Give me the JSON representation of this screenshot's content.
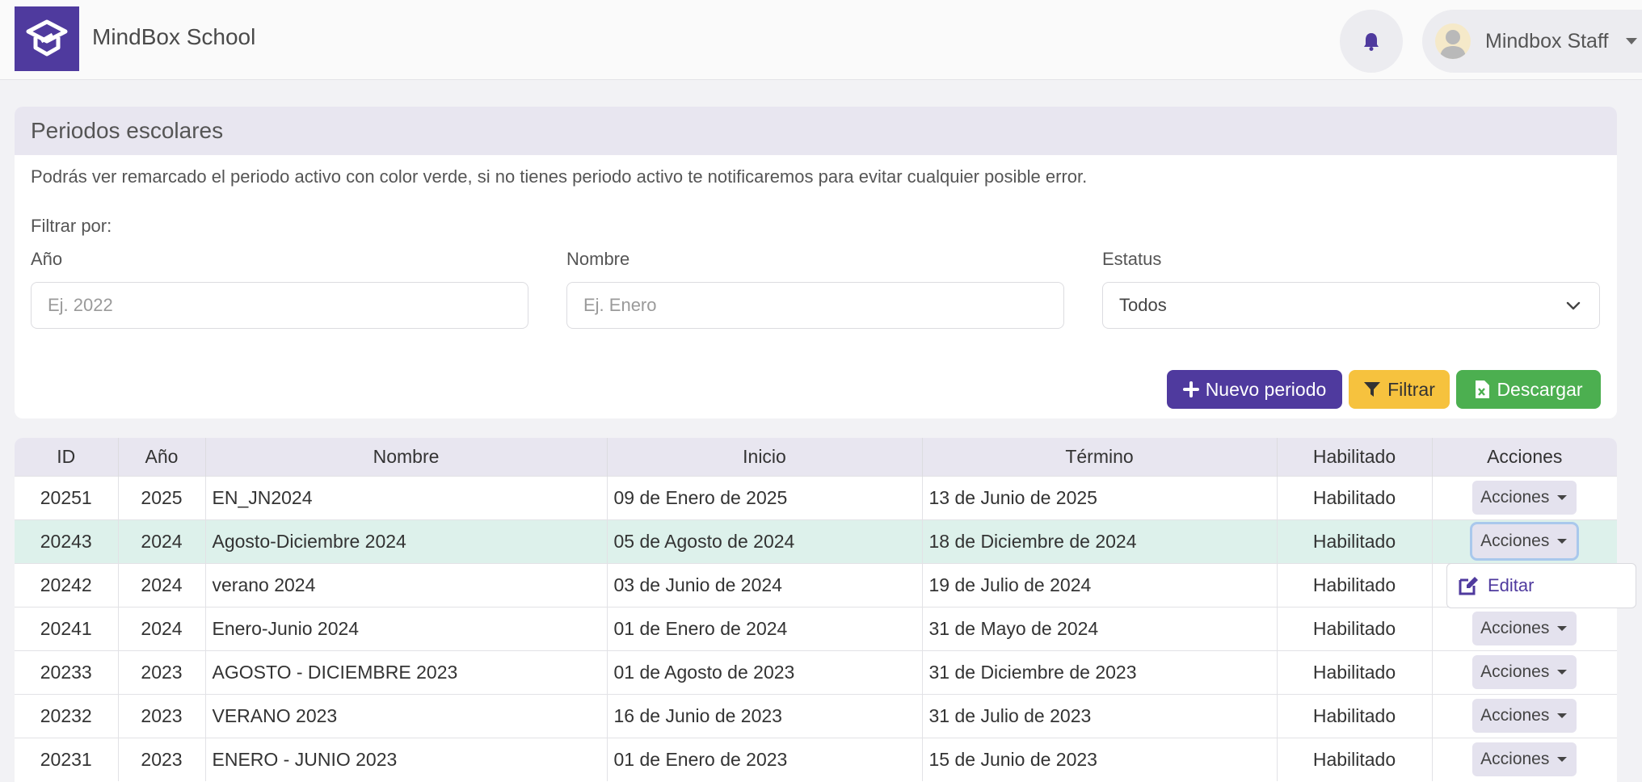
{
  "app": {
    "brand": "MindBox School"
  },
  "header": {
    "user_name": "Mindbox Staff"
  },
  "panel": {
    "title": "Periodos escolares",
    "description": "Podrás ver remarcado el periodo activo con color verde, si no tienes periodo activo te notificaremos para evitar cualquier posible error.",
    "filter_label": "Filtrar por:",
    "filters": {
      "year_label": "Año",
      "year_placeholder": "Ej. 2022",
      "name_label": "Nombre",
      "name_placeholder": "Ej. Enero",
      "status_label": "Estatus",
      "status_value": "Todos"
    },
    "buttons": {
      "new_label": "Nuevo periodo",
      "filter_label": "Filtrar",
      "download_label": "Descargar"
    }
  },
  "table": {
    "headers": [
      "ID",
      "Año",
      "Nombre",
      "Inicio",
      "Término",
      "Habilitado",
      "Acciones"
    ],
    "rows": [
      {
        "id": "20251",
        "year": "2025",
        "name": "EN_JN2024",
        "start": "09 de Enero de 2025",
        "end": "13 de Junio de 2025",
        "enabled": "Habilitado",
        "action": "Acciones"
      },
      {
        "id": "20243",
        "year": "2024",
        "name": "Agosto-Diciembre 2024",
        "start": "05 de Agosto de 2024",
        "end": "18 de Diciembre de 2024",
        "enabled": "Habilitado",
        "action": "Acciones"
      },
      {
        "id": "20242",
        "year": "2024",
        "name": "verano 2024",
        "start": "03 de Junio de 2024",
        "end": "19 de Julio de 2024",
        "enabled": "Habilitado",
        "action": "Acciones"
      },
      {
        "id": "20241",
        "year": "2024",
        "name": "Enero-Junio 2024",
        "start": "01 de Enero de 2024",
        "end": "31 de Mayo de 2024",
        "enabled": "Habilitado",
        "action": "Acciones"
      },
      {
        "id": "20233",
        "year": "2023",
        "name": "AGOSTO - DICIEMBRE 2023",
        "start": "01 de Agosto de 2023",
        "end": "31 de Diciembre de 2023",
        "enabled": "Habilitado",
        "action": "Acciones"
      },
      {
        "id": "20232",
        "year": "2023",
        "name": "VERANO 2023",
        "start": "16 de Junio de 2023",
        "end": "31 de Julio de 2023",
        "enabled": "Habilitado",
        "action": "Acciones"
      },
      {
        "id": "20231",
        "year": "2023",
        "name": "ENERO - JUNIO 2023",
        "start": "01 de Enero de 2023",
        "end": "15 de Junio de 2023",
        "enabled": "Habilitado",
        "action": "Acciones"
      }
    ]
  },
  "dropdown": {
    "edit_label": "Editar"
  },
  "colors": {
    "brand": "#4f3a9e",
    "active_row": "#ddf1eb",
    "filter_button": "#f6c23e",
    "download_button": "#4caf50"
  }
}
